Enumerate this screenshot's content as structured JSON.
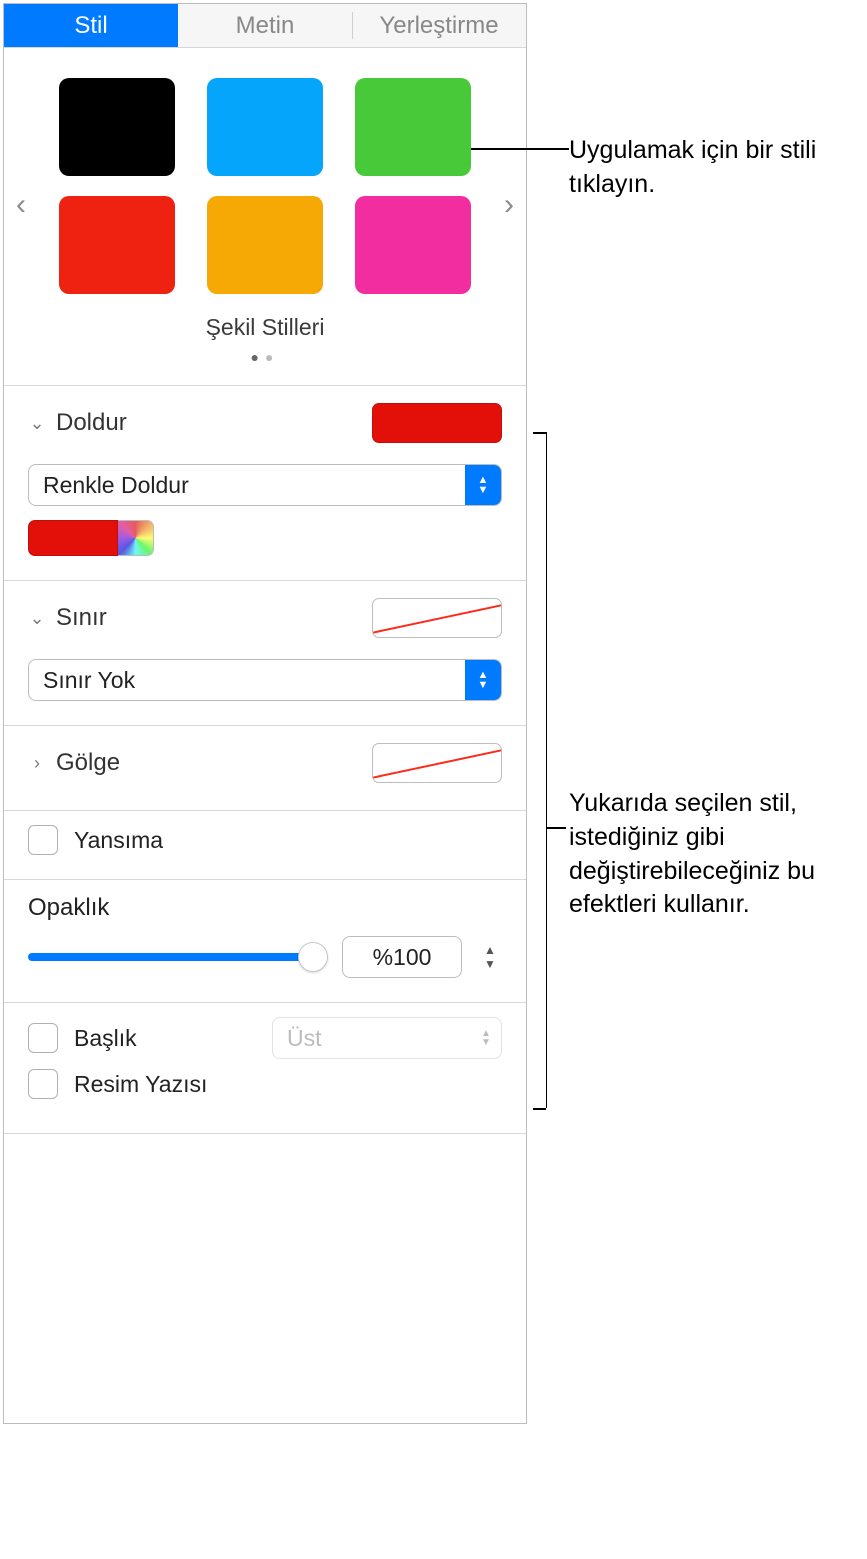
{
  "tabs": {
    "style": "Stil",
    "text": "Metin",
    "arrange": "Yerleştirme"
  },
  "styles": {
    "label": "Şekil Stilleri",
    "swatches": [
      "#000000",
      "#05a5fb",
      "#47c93a",
      "#ef2212",
      "#f6a805",
      "#f12da0"
    ]
  },
  "fill": {
    "title": "Doldur",
    "mode": "Renkle Doldur",
    "color": "#e30f09"
  },
  "border": {
    "title": "Sınır",
    "mode": "Sınır Yok"
  },
  "shadow": {
    "title": "Gölge"
  },
  "reflection": {
    "title": "Yansıma"
  },
  "opacity": {
    "title": "Opaklık",
    "valueText": "%100",
    "value": 100
  },
  "titleSection": {
    "title": "Başlık",
    "positionLabel": "Üst",
    "caption": "Resim Yazısı"
  },
  "callouts": {
    "clickStyle": "Uygulamak için bir stili tıklayın.",
    "effects": "Yukarıda seçilen stil, istediğiniz gibi değiştirebileceğiniz bu efektleri kullanır."
  }
}
